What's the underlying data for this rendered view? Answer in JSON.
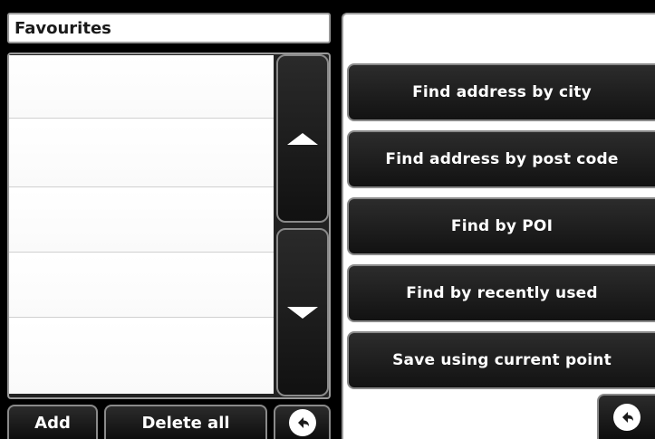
{
  "favourites": {
    "title": "Favourites",
    "rows": [
      "",
      "",
      "",
      "",
      ""
    ],
    "scroll_up_icon": "triangle-up",
    "scroll_down_icon": "triangle-down"
  },
  "bottom_bar": {
    "add_label": "Add",
    "delete_all_label": "Delete all",
    "back_icon": "back-arrow"
  },
  "menu": {
    "items": [
      "Find address by city",
      "Find address by post code",
      "Find by POI",
      "Find by recently used",
      "Save using current point"
    ],
    "back_icon": "back-arrow"
  },
  "colors": {
    "background": "#000000",
    "panel": "#ffffff",
    "button": "#1a1a1a",
    "button_border": "#8a8a8a",
    "button_text": "#ffffff"
  }
}
